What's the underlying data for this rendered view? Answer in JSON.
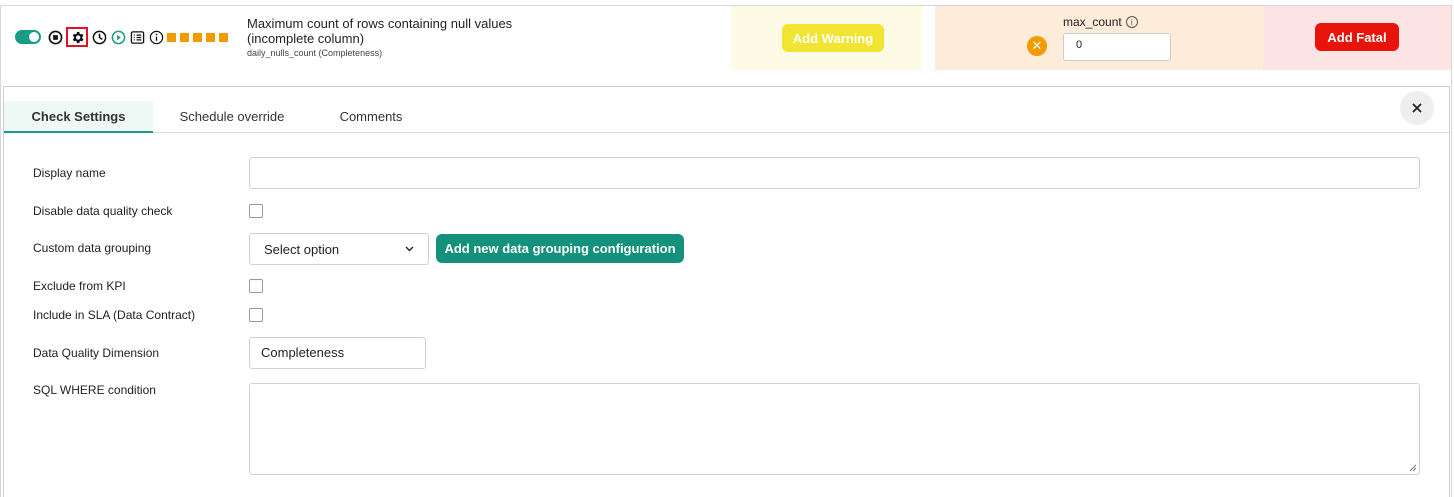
{
  "check": {
    "title": "Maximum count of rows containing null values (incomplete column)",
    "subtitle": "daily_nulls_count (Completeness)",
    "status_colors": [
      "#f29b00",
      "#f29b00",
      "#f29b00",
      "#f29b00",
      "#f29b00"
    ]
  },
  "rules": {
    "warning_button": "Add Warning",
    "error_param_label": "max_count",
    "error_param_value": "0",
    "fatal_button": "Add Fatal"
  },
  "tabs": [
    {
      "label": "Check Settings",
      "active": true
    },
    {
      "label": "Schedule override",
      "active": false
    },
    {
      "label": "Comments",
      "active": false
    }
  ],
  "form": {
    "display_name_label": "Display name",
    "display_name_value": "",
    "disable_label": "Disable data quality check",
    "grouping_label": "Custom data grouping",
    "grouping_select": "Select option",
    "grouping_button": "Add new data grouping configuration",
    "exclude_kpi_label": "Exclude from KPI",
    "include_sla_label": "Include in SLA (Data Contract)",
    "dimension_label": "Data Quality Dimension",
    "dimension_value": "Completeness",
    "where_label": "SQL WHERE condition",
    "where_value": ""
  },
  "colors": {
    "accent": "#1a9b83",
    "warning": "#f1e432",
    "error": "#f29b00",
    "fatal": "#e8140c"
  }
}
